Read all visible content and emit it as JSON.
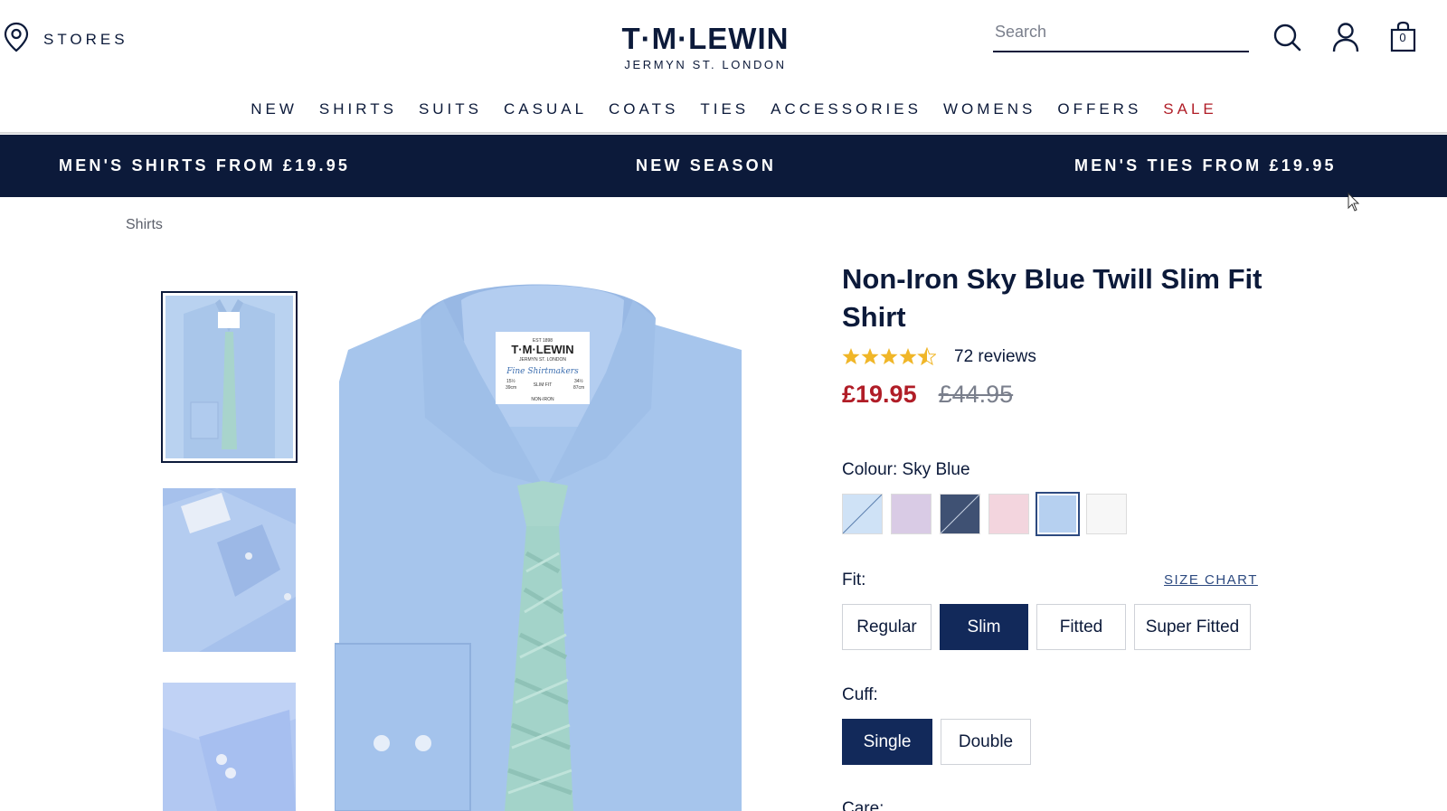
{
  "header": {
    "stores_label": "STORES",
    "logo_main": "T·M·LEWIN",
    "logo_sub": "JERMYN ST. LONDON",
    "search_placeholder": "Search",
    "bag_count": "0"
  },
  "nav": {
    "items": [
      "NEW",
      "SHIRTS",
      "SUITS",
      "CASUAL",
      "COATS",
      "TIES",
      "ACCESSORIES",
      "WOMENS",
      "OFFERS",
      "SALE"
    ]
  },
  "promo": {
    "left": "MEN'S SHIRTS FROM £19.95",
    "center": "NEW SEASON",
    "right": "MEN'S TIES FROM £19.95"
  },
  "breadcrumb": "Shirts",
  "product": {
    "title": "Non-Iron Sky Blue Twill Slim Fit Shirt",
    "rating": 4.5,
    "reviews": "72 reviews",
    "price_now": "£19.95",
    "price_was": "£44.95",
    "colour_label": "Colour:",
    "colour_value": "Sky Blue",
    "swatches": [
      {
        "name": "blue-white-stripe",
        "color": "#cfe2f6"
      },
      {
        "name": "lilac",
        "color": "#d9cbe5"
      },
      {
        "name": "navy",
        "color": "#3f5173"
      },
      {
        "name": "pink",
        "color": "#f3d5de"
      },
      {
        "name": "sky-blue",
        "color": "#b6d0f0"
      },
      {
        "name": "white",
        "color": "#f7f7f7"
      }
    ],
    "fit_label": "Fit:",
    "size_chart": "SIZE CHART",
    "fits": [
      "Regular",
      "Slim",
      "Fitted",
      "Super Fitted"
    ],
    "fit_selected": "Slim",
    "cuff_label": "Cuff:",
    "cuffs": [
      "Single",
      "Double"
    ],
    "cuff_selected": "Single",
    "care_label": "Care:"
  },
  "label": {
    "brand": "T·M·LEWIN",
    "line2": "JERMYN ST. LONDON",
    "est": "EST 1898",
    "script": "Fine Shirtmakers",
    "neck_in": "15½",
    "neck_cm": "39cm",
    "fit": "SLIM FIT",
    "sleeve_in": "34½",
    "sleeve_cm": "87cm",
    "care": "NON-IRON"
  },
  "colors": {
    "navy": "#0c1a3a",
    "sale_red": "#b01d27",
    "selected_button": "#12295a"
  }
}
